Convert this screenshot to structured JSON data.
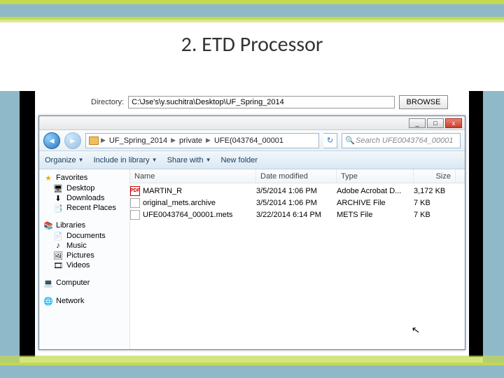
{
  "slide": {
    "title": "2. ETD Processor"
  },
  "dirbar": {
    "label": "Directory:",
    "path": "C:\\Jse's\\y.suchitra\\Desktop\\UF_Spring_2014",
    "browse": "BROWSE"
  },
  "window": {
    "min": "_",
    "max": "□",
    "close": "x",
    "breadcrumb": [
      "UF_Spring_2014",
      "private",
      "UFE(043764_00001"
    ],
    "search_placeholder": "Search UFE0043764_00001"
  },
  "toolbar": {
    "organize": "Organize",
    "include": "Include in library",
    "share": "Share with",
    "newfolder": "New folder"
  },
  "sidebar": {
    "favorites": {
      "label": "Favorites",
      "items": [
        "Desktop",
        "Downloads",
        "Recent Places"
      ]
    },
    "libraries": {
      "label": "Libraries",
      "items": [
        "Documents",
        "Music",
        "Pictures",
        "Videos"
      ]
    },
    "computer": {
      "label": "Computer"
    },
    "network": {
      "label": "Network"
    }
  },
  "columns": {
    "name": "Name",
    "date": "Date modified",
    "type": "Type",
    "size": "Size"
  },
  "files": [
    {
      "icon": "pdf",
      "name": "MARTIN_R",
      "date": "3/5/2014 1:06 PM",
      "type": "Adobe Acrobat D...",
      "size": "3,172 KB"
    },
    {
      "icon": "generic",
      "name": "original_mets.archive",
      "date": "3/5/2014 1:06 PM",
      "type": "ARCHIVE File",
      "size": "7 KB"
    },
    {
      "icon": "generic",
      "name": "UFE0043764_00001.mets",
      "date": "3/22/2014 6:14 PM",
      "type": "METS File",
      "size": "7 KB"
    }
  ]
}
